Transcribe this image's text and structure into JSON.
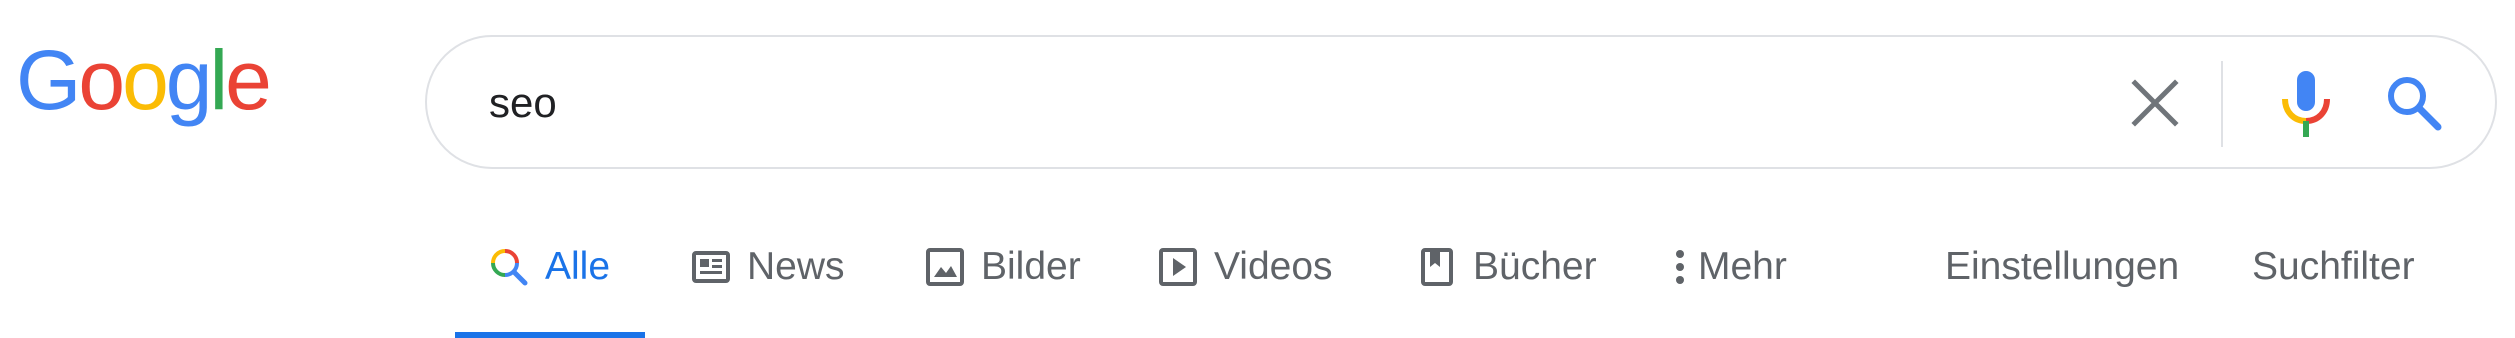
{
  "logo": {
    "letters": [
      "G",
      "o",
      "o",
      "g",
      "l",
      "e"
    ],
    "colors": [
      "#4285F4",
      "#EA4335",
      "#FBBC05",
      "#4285F4",
      "#34A853",
      "#EA4335"
    ]
  },
  "search": {
    "value": "seo",
    "clear_icon": "close-icon",
    "mic_icon": "microphone-icon",
    "search_icon": "search-icon"
  },
  "tabs": [
    {
      "label": "Alle",
      "icon": "search-multicolor-icon",
      "active": true
    },
    {
      "label": "News",
      "icon": "news-icon",
      "active": false
    },
    {
      "label": "Bilder",
      "icon": "image-icon",
      "active": false
    },
    {
      "label": "Videos",
      "icon": "video-icon",
      "active": false
    },
    {
      "label": "Bücher",
      "icon": "book-icon",
      "active": false
    },
    {
      "label": "Mehr",
      "icon": "more-vert-icon",
      "active": false
    }
  ],
  "tools": {
    "settings": "Einstellungen",
    "filter": "Suchfilter"
  },
  "colors": {
    "accent": "#1a73e8",
    "tab_text": "#5f6368",
    "border": "#dfe1e5"
  }
}
